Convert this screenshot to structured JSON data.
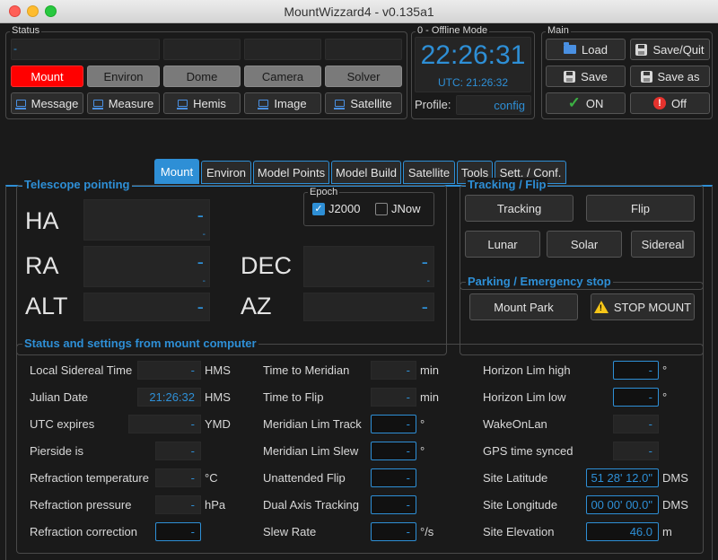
{
  "window": {
    "title": "MountWizzard4 - v0.135a1"
  },
  "status_group": {
    "title": "Status",
    "top_text": "-",
    "device_buttons": [
      "Mount",
      "Environ",
      "Dome",
      "Camera",
      "Solver"
    ],
    "window_buttons": [
      "Message",
      "Measure",
      "Hemis",
      "Image",
      "Satellite"
    ]
  },
  "mode_group": {
    "title": "0 - Offline Mode",
    "clock": "22:26:31",
    "utc": "UTC: 21:26:32",
    "profile_label": "Profile:",
    "profile_value": "config"
  },
  "main_group": {
    "title": "Main",
    "load": "Load",
    "save_quit": "Save/Quit",
    "save": "Save",
    "save_as": "Save as",
    "on": "ON",
    "off": "Off"
  },
  "tabs": [
    "Mount",
    "Environ",
    "Model Points",
    "Model Build",
    "Satellite",
    "Tools",
    "Sett. / Conf."
  ],
  "telescope": {
    "title": "Telescope pointing",
    "ha_label": "HA",
    "ha_value": "-",
    "ha_sub": "-",
    "ra_label": "RA",
    "ra_value": "-",
    "ra_sub": "-",
    "dec_label": "DEC",
    "dec_value": "-",
    "dec_sub": "-",
    "alt_label": "ALT",
    "alt_value": "-",
    "az_label": "AZ",
    "az_value": "-",
    "epoch_title": "Epoch",
    "j2000": "J2000",
    "jnow": "JNow"
  },
  "tracking": {
    "title": "Tracking / Flip",
    "tracking": "Tracking",
    "flip": "Flip",
    "lunar": "Lunar",
    "solar": "Solar",
    "sidereal": "Sidereal"
  },
  "parking": {
    "title": "Parking / Emergency stop",
    "park": "Mount Park",
    "stop": "STOP MOUNT"
  },
  "mount_status": {
    "title": "Status and settings from mount computer",
    "col1": [
      {
        "label": "Local Sidereal Time",
        "value": "-",
        "unit": "HMS"
      },
      {
        "label": "Julian Date",
        "value": "21:26:32",
        "unit": "HMS"
      },
      {
        "label": "UTC expires",
        "value": "-",
        "unit": "YMD"
      },
      {
        "label": "Pierside is",
        "value": "-",
        "unit": ""
      },
      {
        "label": "Refraction temperature",
        "value": "-",
        "unit": "°C"
      },
      {
        "label": "Refraction pressure",
        "value": "-",
        "unit": "hPa"
      },
      {
        "label": "Refraction correction",
        "value": "-",
        "unit": ""
      }
    ],
    "col2": [
      {
        "label": "Time to Meridian",
        "value": "-",
        "unit": "min"
      },
      {
        "label": "Time to Flip",
        "value": "-",
        "unit": "min"
      },
      {
        "label": "Meridian Lim Track",
        "value": "-",
        "unit": "°"
      },
      {
        "label": "Meridian Lim Slew",
        "value": "-",
        "unit": "°"
      },
      {
        "label": "Unattended Flip",
        "value": "-",
        "unit": ""
      },
      {
        "label": "Dual Axis Tracking",
        "value": "-",
        "unit": ""
      },
      {
        "label": "Slew Rate",
        "value": "-",
        "unit": "°/s"
      }
    ],
    "col3": [
      {
        "label": "Horizon Lim high",
        "value": "-",
        "unit": "°"
      },
      {
        "label": "Horizon Lim low",
        "value": "-",
        "unit": "°"
      },
      {
        "label": "WakeOnLan",
        "value": "-",
        "unit": ""
      },
      {
        "label": "GPS time synced",
        "value": "-",
        "unit": ""
      },
      {
        "label": "Site Latitude",
        "value": "51 28' 12.0\"",
        "unit": "DMS"
      },
      {
        "label": "Site Longitude",
        "value": "00 00' 00.0\"",
        "unit": "DMS"
      },
      {
        "label": "Site Elevation",
        "value": "46.0",
        "unit": "m"
      }
    ]
  }
}
